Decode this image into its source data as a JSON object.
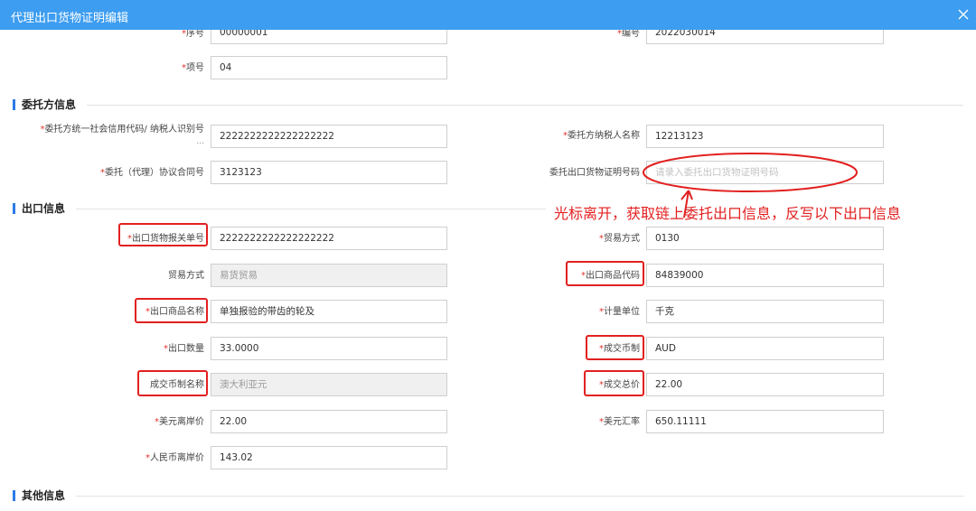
{
  "dialog": {
    "title": "代理出口货物证明编辑"
  },
  "sections": {
    "entrust": "委托方信息",
    "export": "出口信息",
    "other": "其他信息"
  },
  "fields": {
    "seq": {
      "label": "序号",
      "required": "*",
      "value": "00000001"
    },
    "number": {
      "label": "编号",
      "required": "*",
      "value": "2022030014"
    },
    "item_no": {
      "label": "项号",
      "required": "*",
      "value": "04"
    },
    "credit_code": {
      "label": "委托方统一社会信用代码/ 纳税人识别号",
      "label_extra": "...",
      "required": "*",
      "value": "2222222222222222222"
    },
    "taxpayer_name": {
      "label": "委托方纳税人名称",
      "required": "*",
      "value": "12213123"
    },
    "contract_no": {
      "label": "委托（代理）协议合同号",
      "required": "*",
      "value": "3123123"
    },
    "cert_no": {
      "label": "委托出口货物证明号码",
      "required": "",
      "placeholder": "请录入委托出口货物证明号码"
    },
    "customs_no": {
      "label": "出口货物报关单号",
      "required": "*",
      "value": "2222222222222222222"
    },
    "trade_mode_code": {
      "label": "贸易方式",
      "required": "*",
      "value": "0130"
    },
    "trade_mode_name": {
      "label": "贸易方式",
      "required": "",
      "value": "易货贸易"
    },
    "goods_code": {
      "label": "出口商品代码",
      "required": "*",
      "value": "84839000"
    },
    "goods_name": {
      "label": "出口商品名称",
      "required": "*",
      "value": "单独报验的带齿的轮及"
    },
    "unit": {
      "label": "计量单位",
      "required": "*",
      "value": "千克"
    },
    "quantity": {
      "label": "出口数量",
      "required": "*",
      "value": "33.0000"
    },
    "currency": {
      "label": "成交币制",
      "required": "*",
      "value": "AUD"
    },
    "currency_name": {
      "label": "成交币制名称",
      "required": "",
      "value": "澳大利亚元"
    },
    "total_price": {
      "label": "成交总价",
      "required": "*",
      "value": "22.00"
    },
    "usd_fob": {
      "label": "美元离岸价",
      "required": "*",
      "value": "22.00"
    },
    "usd_rate": {
      "label": "美元汇率",
      "required": "*",
      "value": "650.11111"
    },
    "cny_fob": {
      "label": "人民币离岸价",
      "required": "*",
      "value": "143.02"
    }
  },
  "annotation": {
    "text": "光标离开，获取链上委托出口信息，反写以下出口信息"
  },
  "colors": {
    "titlebar": "#3d9df0",
    "required": "#e0322b",
    "annotation": "#e22020",
    "section_bar": "#2c7be5"
  }
}
